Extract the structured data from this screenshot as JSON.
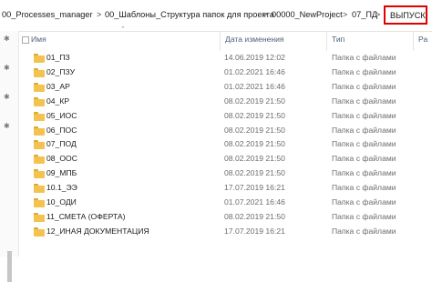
{
  "breadcrumb": {
    "items": [
      "00_Processes_manager",
      "00_Шаблоны_Структура папок для проекта",
      "00000_NewProject",
      "07_ПД"
    ],
    "current": "ВЫПУСК",
    "separator": ">"
  },
  "columns": {
    "name": "Имя",
    "date": "Дата изменения",
    "type": "Тип",
    "size": "Ра"
  },
  "rows": [
    {
      "name": "01_ПЗ",
      "date": "14.06.2019 12:02",
      "type": "Папка с файлами"
    },
    {
      "name": "02_ПЗУ",
      "date": "01.02.2021 16:46",
      "type": "Папка с файлами"
    },
    {
      "name": "03_АР",
      "date": "01.02.2021 16:46",
      "type": "Папка с файлами"
    },
    {
      "name": "04_КР",
      "date": "08.02.2019 21:50",
      "type": "Папка с файлами"
    },
    {
      "name": "05_ИОС",
      "date": "08.02.2019 21:50",
      "type": "Папка с файлами"
    },
    {
      "name": "06_ПОС",
      "date": "08.02.2019 21:50",
      "type": "Папка с файлами"
    },
    {
      "name": "07_ПОД",
      "date": "08.02.2019 21:50",
      "type": "Папка с файлами"
    },
    {
      "name": "08_ООС",
      "date": "08.02.2019 21:50",
      "type": "Папка с файлами"
    },
    {
      "name": "09_МПБ",
      "date": "08.02.2019 21:50",
      "type": "Папка с файлами"
    },
    {
      "name": "10.1_ЭЭ",
      "date": "17.07.2019 16:21",
      "type": "Папка с файлами"
    },
    {
      "name": "10_ОДИ",
      "date": "01.07.2021 16:46",
      "type": "Папка с файлами"
    },
    {
      "name": "11_СМЕТА (ОФЕРТА)",
      "date": "08.02.2019 21:50",
      "type": "Папка с файлами"
    },
    {
      "name": "12_ИНАЯ ДОКУМЕНТАЦИЯ",
      "date": "17.07.2019 16:21",
      "type": "Папка с файлами"
    }
  ],
  "icons": {
    "folder": "folder-icon",
    "pin": "pin-icon",
    "sort": "sort-up-icon"
  },
  "colors": {
    "highlight_border": "#e00000",
    "folder": "#f4c24f",
    "header_text": "#4c607a"
  }
}
